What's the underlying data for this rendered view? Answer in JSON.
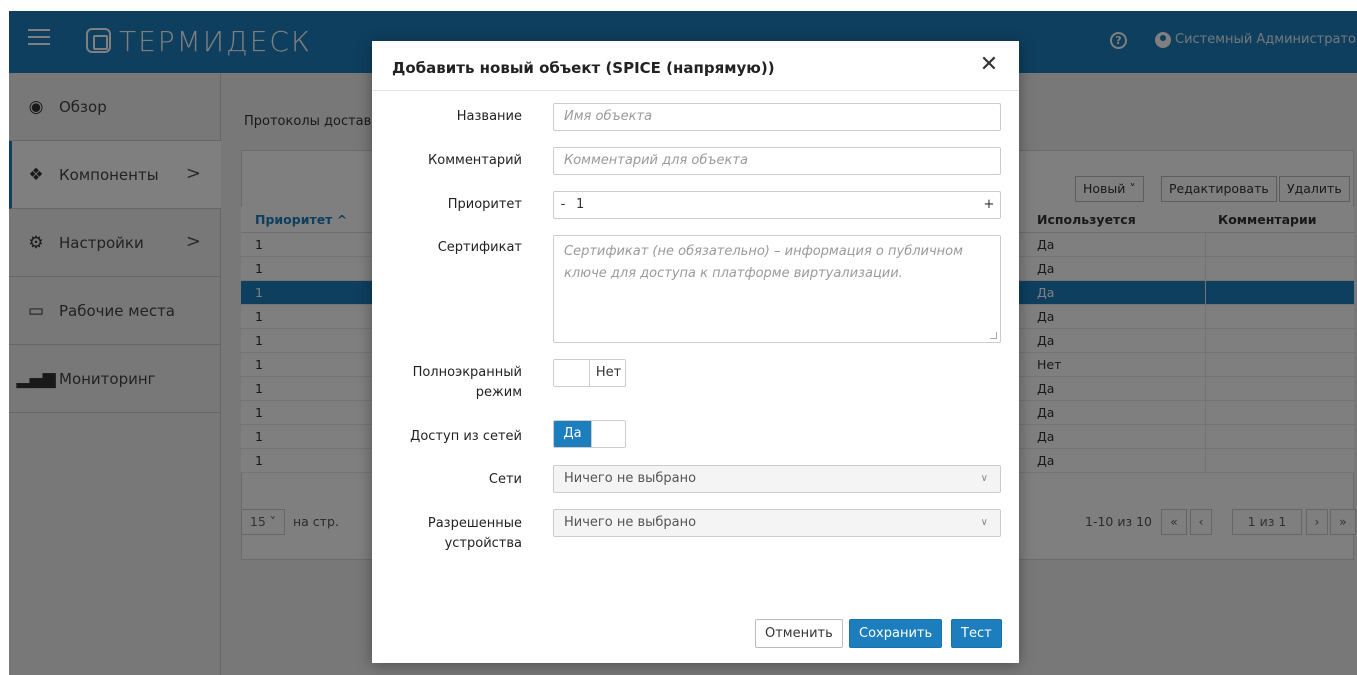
{
  "app": {
    "logo_text": "ТЕРМИДЕСК",
    "user_name": "Системный Администратор",
    "help_icon": "help-circle-icon",
    "user_icon": "user-circle-icon"
  },
  "sidebar": {
    "items": [
      {
        "label": "Обзор",
        "icon": "dashboard-icon"
      },
      {
        "label": "Компоненты",
        "icon": "components-icon",
        "chevron": ">"
      },
      {
        "label": "Настройки",
        "icon": "settings-icon",
        "chevron": ">"
      },
      {
        "label": "Рабочие места",
        "icon": "monitor-icon"
      },
      {
        "label": "Мониторинг",
        "icon": "bar-chart-icon"
      }
    ]
  },
  "content": {
    "breadcrumb": "Протоколы доставки",
    "toolbar": {
      "new_label": "Новый",
      "edit_label": "Редактировать",
      "delete_label": "Удалить"
    },
    "table": {
      "headers": {
        "priority": "Приоритет",
        "used": "Используется",
        "comments": "Комментарии"
      },
      "rows": [
        {
          "priority": "1",
          "used": "Да"
        },
        {
          "priority": "1",
          "used": "Да"
        },
        {
          "priority": "1",
          "used": "Да",
          "selected": true
        },
        {
          "priority": "1",
          "used": "Да"
        },
        {
          "priority": "1",
          "used": "Да"
        },
        {
          "priority": "1",
          "used": "Нет"
        },
        {
          "priority": "1",
          "used": "Да"
        },
        {
          "priority": "1",
          "used": "Да"
        },
        {
          "priority": "1",
          "used": "Да"
        },
        {
          "priority": "1",
          "used": "Да"
        }
      ]
    },
    "pager": {
      "per_page_value": "15",
      "per_page_label": "на стр.",
      "range": "1-10 из 10",
      "page": "1",
      "of_pages": "из 1"
    }
  },
  "dialog": {
    "title": "Добавить новый объект (SPICE (напрямую))",
    "close_glyph": "✕",
    "fields": {
      "name_label": "Название",
      "name_placeholder": "Имя объекта",
      "comment_label": "Комментарий",
      "comment_placeholder": "Комментарий для объекта",
      "priority_label": "Приоритет",
      "priority_value": "1",
      "priority_minus": "-",
      "priority_plus": "+",
      "cert_label": "Сертификат",
      "cert_placeholder": "Сертификат (не обязательно) – информация о публичном ключе для доступа к платформе виртуализации.",
      "fullscreen_label_1": "Полноэкранный",
      "fullscreen_label_2": "режим",
      "fullscreen_value": "Нет",
      "network_access_label": "Доступ из сетей",
      "network_access_value": "Да",
      "networks_label": "Сети",
      "networks_value": "Ничего не выбрано",
      "devices_label_1": "Разрешенные",
      "devices_label_2": "устройства",
      "devices_value": "Ничего не выбрано"
    },
    "buttons": {
      "cancel": "Отменить",
      "save": "Сохранить",
      "test": "Тест"
    }
  }
}
